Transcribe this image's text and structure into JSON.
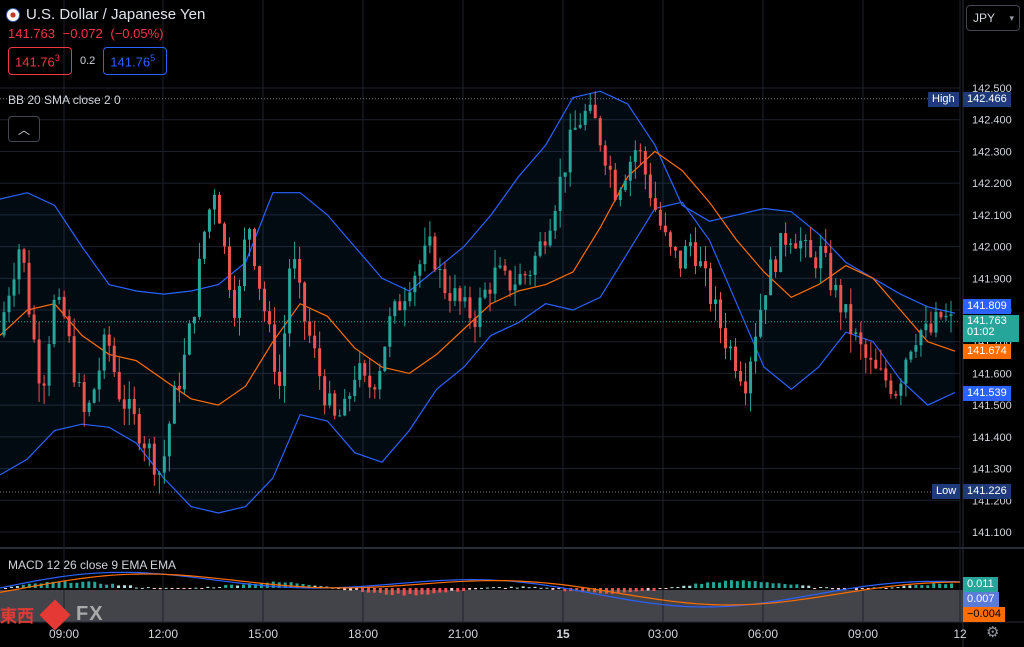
{
  "header": {
    "title": "U.S. Dollar / Japanese Yen",
    "last": "141.763",
    "change": "−0.072",
    "change_pct": "(−0.05%)",
    "sell": "141.76",
    "sell_sup": "3",
    "spread": "0.2",
    "buy": "141.76",
    "buy_sup": "5",
    "currency": "JPY"
  },
  "indicators": {
    "bb": "BB 20 SMA close 2 0",
    "macd": "MACD 12 26 close 9 EMA EMA",
    "collapse": "^"
  },
  "price_tags": {
    "high_label": "High",
    "high": "142.466",
    "upper": "141.809",
    "last": "141.763",
    "countdown": "01:02",
    "mid": "141.674",
    "lower": "141.539",
    "low_label": "Low",
    "low": "141.226",
    "macd": "0.011",
    "signal": "0.007",
    "hist": "−0.004"
  },
  "watermark": {
    "cn": "東西",
    "fx": "FX"
  },
  "colors": {
    "up": "#26a69a",
    "down": "#ef5350",
    "bb_band": "#2962ff",
    "bb_basis": "#ff6d00",
    "price_tag": "#26a69a"
  },
  "chart_data": {
    "type": "candlestick",
    "title": "U.S. Dollar / Japanese Yen",
    "y_range": [
      141.05,
      142.6
    ],
    "y_ticks": [
      "142.500",
      "142.400",
      "142.300",
      "142.200",
      "142.100",
      "142.000",
      "141.900",
      "141.800",
      "141.700",
      "141.600",
      "141.500",
      "141.400",
      "141.300",
      "141.200",
      "141.100"
    ],
    "x_ticks": [
      "09:00",
      "12:00",
      "15:00",
      "18:00",
      "21:00",
      "15",
      "03:00",
      "06:00",
      "09:00",
      "12"
    ],
    "high": 142.466,
    "low": 141.226,
    "close_path": [
      141.72,
      141.88,
      142.02,
      141.75,
      141.55,
      141.82,
      141.78,
      141.6,
      141.45,
      141.58,
      141.72,
      141.55,
      141.48,
      141.42,
      141.35,
      141.28,
      141.5,
      141.62,
      141.8,
      142.05,
      142.2,
      141.95,
      141.78,
      142.1,
      141.9,
      141.72,
      141.55,
      142.0,
      141.8,
      141.68,
      141.55,
      141.45,
      141.48,
      141.62,
      141.55,
      141.6,
      141.75,
      141.82,
      141.9,
      141.95,
      142.0,
      141.88,
      141.85,
      141.8,
      141.78,
      141.86,
      141.92,
      141.88,
      141.9,
      141.92,
      142.0,
      142.1,
      142.22,
      142.35,
      142.42,
      142.4,
      142.3,
      142.18,
      142.25,
      142.32,
      142.2,
      142.08,
      141.98,
      141.95,
      142.02,
      141.92,
      141.82,
      141.72,
      141.65,
      141.58,
      141.75,
      141.9,
      141.98,
      142.05,
      142.02,
      141.95,
      141.98,
      141.88,
      141.8,
      141.72,
      141.65,
      141.6,
      141.58,
      141.55,
      141.68,
      141.74,
      141.72,
      141.78,
      141.76
    ],
    "bb_upper_path": [
      142.15,
      142.17,
      142.13,
      142.0,
      141.88,
      141.86,
      141.85,
      141.86,
      141.88,
      141.95,
      142.17,
      142.17,
      142.1,
      142.0,
      141.9,
      141.86,
      141.93,
      142.0,
      142.1,
      142.22,
      142.32,
      142.47,
      142.49,
      142.45,
      142.32,
      142.13,
      142.08,
      142.1,
      142.12,
      142.11,
      142.04,
      141.95,
      141.9,
      141.85,
      141.81,
      141.79
    ],
    "bb_basis_path": [
      141.72,
      141.8,
      141.82,
      141.72,
      141.66,
      141.64,
      141.58,
      141.52,
      141.5,
      141.56,
      141.7,
      141.82,
      141.78,
      141.68,
      141.62,
      141.6,
      141.66,
      141.74,
      141.82,
      141.86,
      141.88,
      141.92,
      142.06,
      142.22,
      142.3,
      142.24,
      142.14,
      142.02,
      141.92,
      141.84,
      141.88,
      141.94,
      141.9,
      141.8,
      141.7,
      141.67
    ],
    "bb_lower_path": [
      141.28,
      141.33,
      141.42,
      141.44,
      141.43,
      141.38,
      141.27,
      141.18,
      141.16,
      141.18,
      141.27,
      141.47,
      141.45,
      141.35,
      141.32,
      141.42,
      141.55,
      141.62,
      141.72,
      141.76,
      141.82,
      141.8,
      141.84,
      141.98,
      142.12,
      142.14,
      142.02,
      141.82,
      141.62,
      141.55,
      141.62,
      141.73,
      141.7,
      141.58,
      141.5,
      141.54
    ],
    "macd_hist_unit": "price"
  }
}
